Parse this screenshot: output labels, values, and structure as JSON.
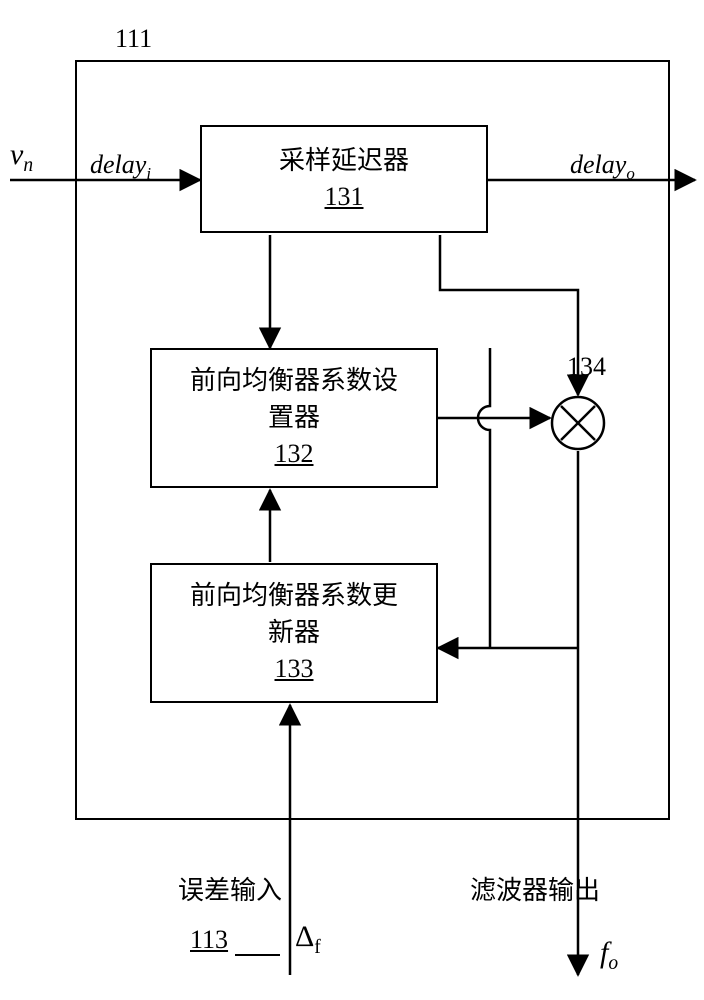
{
  "outer_label": "111",
  "input_v": "v",
  "input_v_sub": "n",
  "delay_in": "delay",
  "delay_in_sub": "i",
  "delay_out": "delay",
  "delay_out_sub": "o",
  "box131_line1": "采样延迟器",
  "box131_ref": "131",
  "box132_line1": "前向均衡器系数设",
  "box132_line2": "置器",
  "box132_ref": "132",
  "box133_line1": "前向均衡器系数更",
  "box133_line2": "新器",
  "box133_ref": "133",
  "mult_label": "134",
  "error_label": "误差输入",
  "filter_label": "滤波器输出",
  "delta": "Δ",
  "delta_sub": "f",
  "ref113": "113",
  "f_out": "f",
  "f_out_sub": "o"
}
